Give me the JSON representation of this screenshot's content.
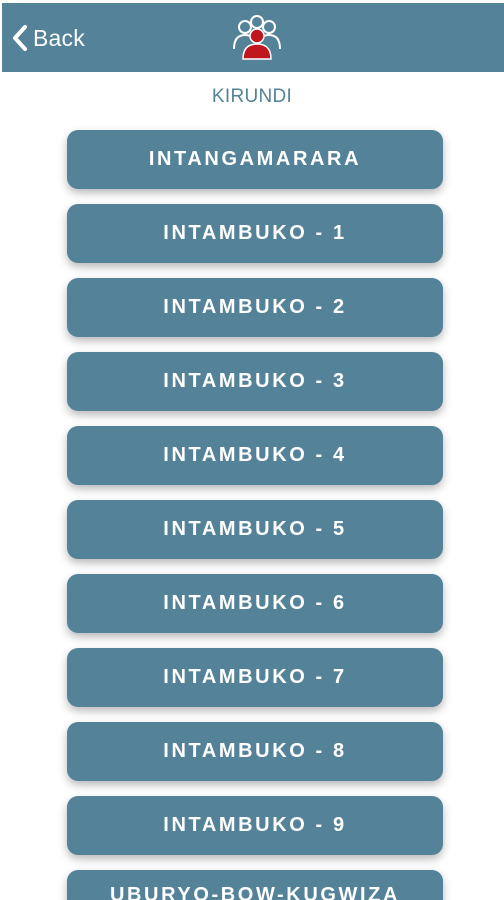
{
  "header": {
    "back_label": "Back",
    "background_color": "#548299",
    "logo_icon": "group-people-icon"
  },
  "subtitle": "KIRUNDI",
  "accent_color": "#548299",
  "menu": {
    "items": [
      {
        "label": "INTANGAMARARA"
      },
      {
        "label": "INTAMBUKO - 1"
      },
      {
        "label": "INTAMBUKO - 2"
      },
      {
        "label": "INTAMBUKO - 3"
      },
      {
        "label": "INTAMBUKO - 4"
      },
      {
        "label": "INTAMBUKO - 5"
      },
      {
        "label": "INTAMBUKO - 6"
      },
      {
        "label": "INTAMBUKO - 7"
      },
      {
        "label": "INTAMBUKO - 8"
      },
      {
        "label": "INTAMBUKO - 9"
      },
      {
        "label": "UBURYO-BOW-KUGWIZA"
      }
    ]
  }
}
